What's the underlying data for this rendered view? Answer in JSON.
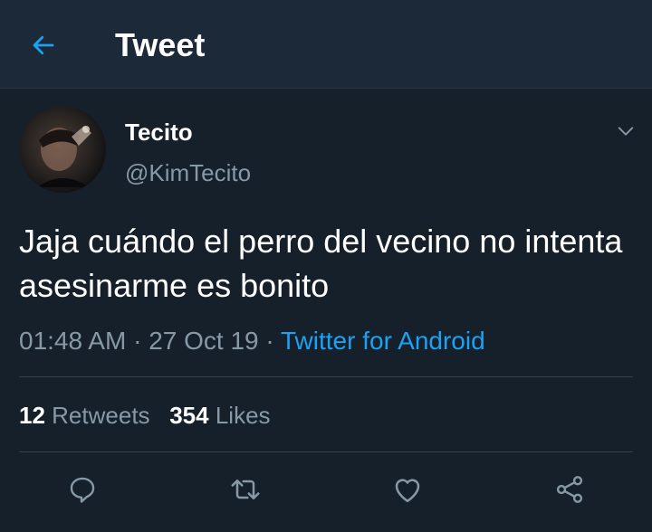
{
  "header": {
    "title": "Tweet",
    "back_icon": "arrow-left-icon"
  },
  "author": {
    "display_name": "Tecito",
    "handle": "@KimTecito"
  },
  "tweet": {
    "text": "Jaja cuándo el perro del vecino no intenta asesinarme es bonito",
    "time": "01:48 AM",
    "sep1": " · ",
    "date": "27 Oct 19",
    "sep2": " · ",
    "source": "Twitter for Android"
  },
  "stats": {
    "retweets_count": "12",
    "retweets_label": "Retweets",
    "likes_count": "354",
    "likes_label": "Likes"
  },
  "actions": [
    "reply-icon",
    "retweet-icon",
    "like-icon",
    "share-icon"
  ],
  "colors": {
    "background": "#15202b",
    "header": "#1c2938",
    "accent": "#1da1f2",
    "secondary_text": "#8899a6",
    "divider": "#38444d"
  }
}
